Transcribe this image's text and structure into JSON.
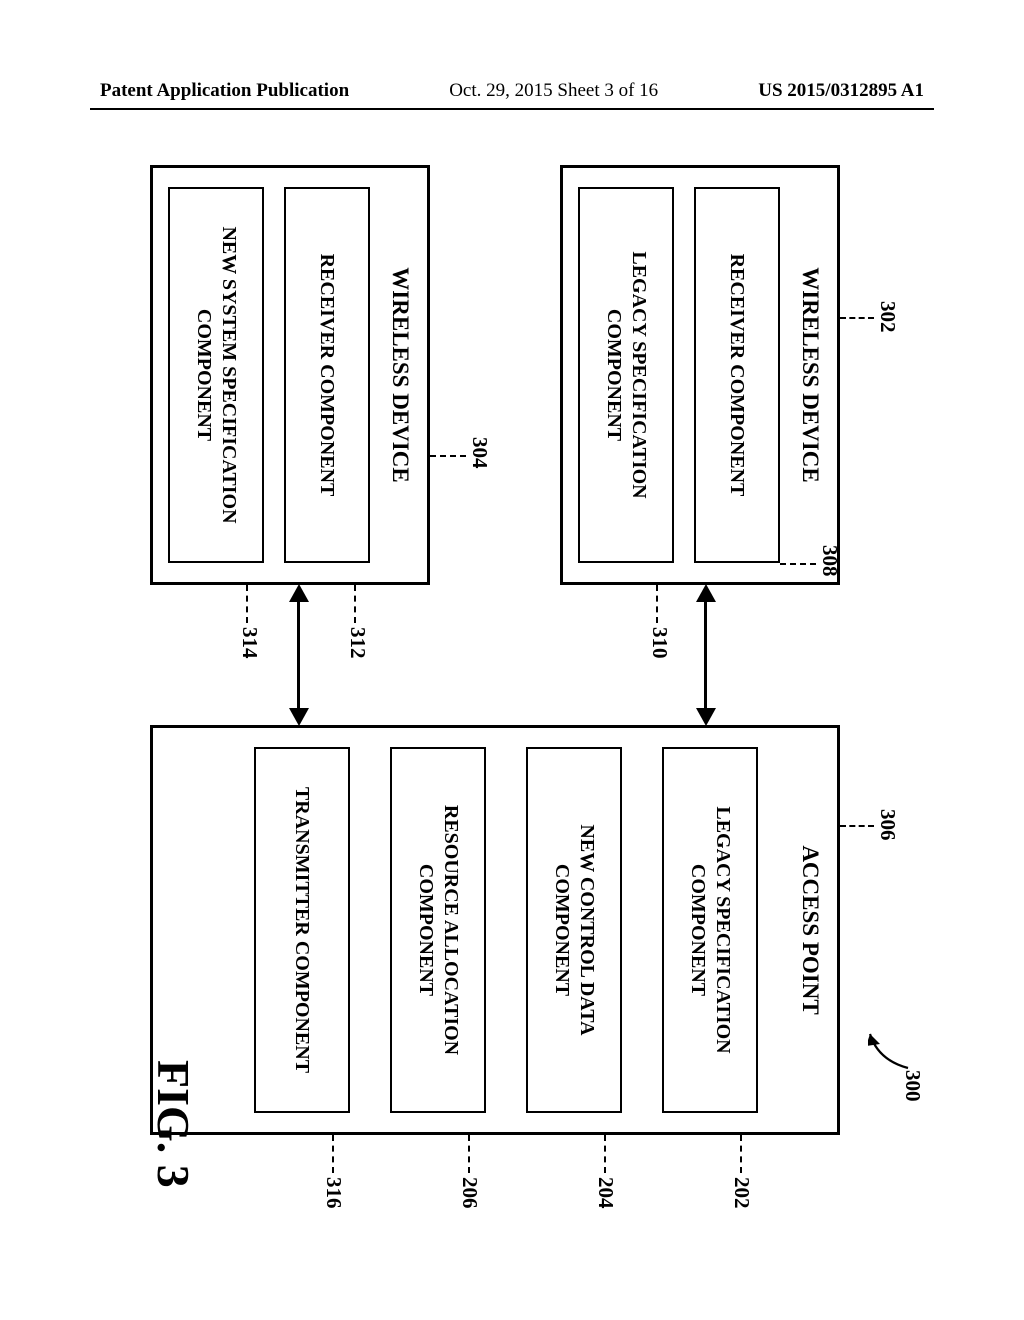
{
  "header": {
    "left": "Patent Application Publication",
    "mid": "Oct. 29, 2015  Sheet 3 of 16",
    "right": "US 2015/0312895 A1"
  },
  "refs": {
    "n300": "300",
    "n302": "302",
    "n304": "304",
    "n306": "306",
    "n308": "308",
    "n310": "310",
    "n312": "312",
    "n314": "314",
    "n202": "202",
    "n204": "204",
    "n206": "206",
    "n316": "316"
  },
  "boxes": {
    "wd1_title": "WIRELESS DEVICE",
    "wd2_title": "WIRELESS DEVICE",
    "ap_title": "ACCESS POINT",
    "recv1": "RECEIVER COMPONENT",
    "legacy_spec1": "LEGACY SPECIFICATION COMPONENT",
    "recv2": "RECEIVER COMPONENT",
    "new_sys_spec": "NEW SYSTEM SPECIFICATION COMPONENT",
    "legacy_spec2": "LEGACY SPECIFICATION COMPONENT",
    "new_ctrl": "NEW CONTROL DATA COMPONENT",
    "res_alloc": "RESOURCE ALLOCATION COMPONENT",
    "tx": "TRANSMITTER COMPONENT"
  },
  "fig_caption": "FIG. 3"
}
